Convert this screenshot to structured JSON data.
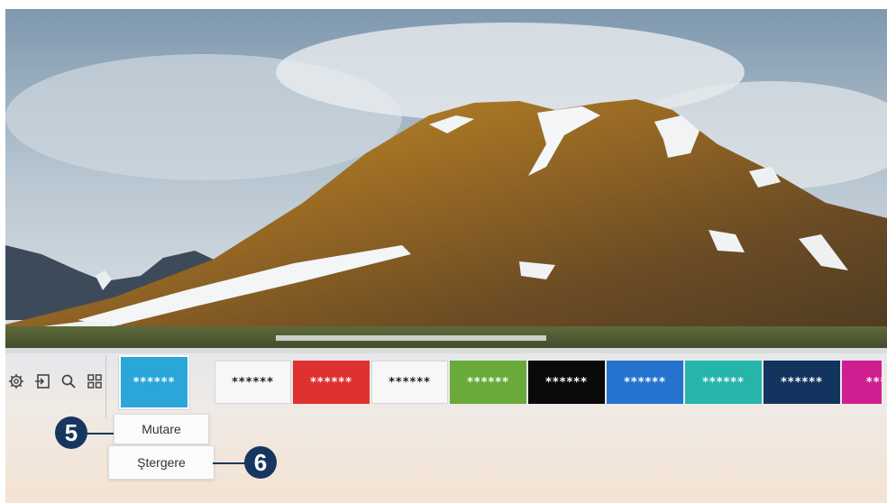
{
  "system_icons": [
    {
      "name": "settings-icon"
    },
    {
      "name": "source-icon"
    },
    {
      "name": "search-icon"
    },
    {
      "name": "apps-icon"
    }
  ],
  "tiles": [
    {
      "label": "******",
      "bg": "#2aa6d8",
      "fg": "#ffffff",
      "selected": true
    },
    {
      "label": "******",
      "bg": "#f7f7f7",
      "fg": "#222222"
    },
    {
      "label": "******",
      "bg": "#e03131",
      "fg": "#ffffff"
    },
    {
      "label": "******",
      "bg": "#f7f7f7",
      "fg": "#222222"
    },
    {
      "label": "******",
      "bg": "#6aaa3a",
      "fg": "#ffffff"
    },
    {
      "label": "******",
      "bg": "#0a0a0a",
      "fg": "#ffffff"
    },
    {
      "label": "******",
      "bg": "#2673cf",
      "fg": "#ffffff"
    },
    {
      "label": "******",
      "bg": "#26b5aa",
      "fg": "#ffffff"
    },
    {
      "label": "******",
      "bg": "#12345f",
      "fg": "#ffffff"
    },
    {
      "label": "****",
      "bg": "#cf1e8f",
      "fg": "#ffffff"
    }
  ],
  "menu": {
    "move_label": "Mutare",
    "delete_label": "Ştergere"
  },
  "callouts": {
    "move_number": "5",
    "delete_number": "6"
  },
  "colors": {
    "callout": "#17365f"
  }
}
